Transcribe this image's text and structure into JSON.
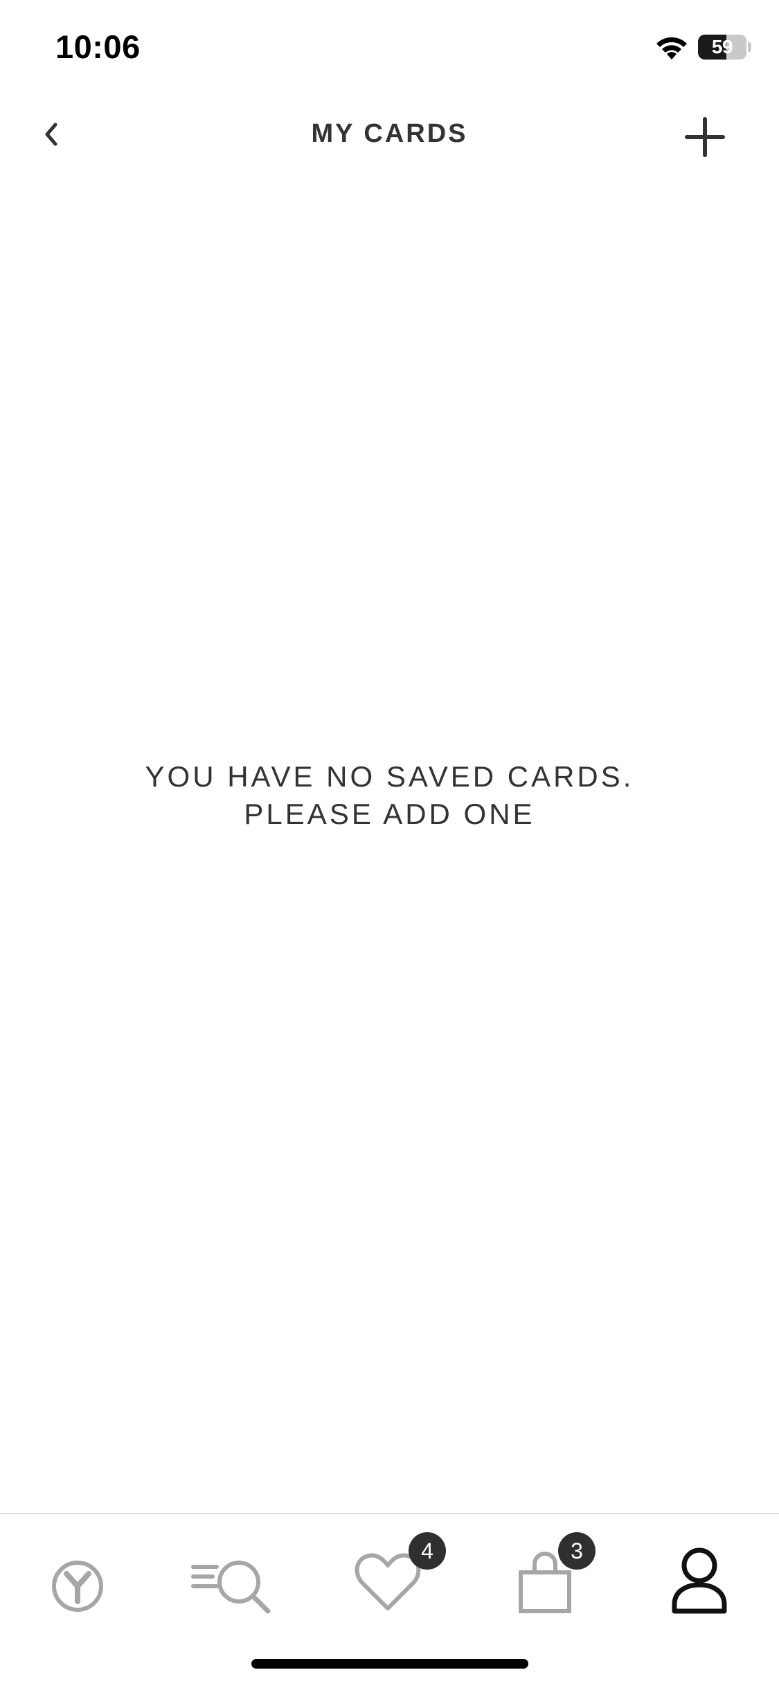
{
  "status_bar": {
    "time": "10:06",
    "battery_percent": "59"
  },
  "header": {
    "title": "MY CARDS",
    "back_icon": "chevron-left-icon",
    "add_icon": "plus-icon"
  },
  "empty_state": {
    "line1": "YOU HAVE NO SAVED CARDS.",
    "line2": "PLEASE ADD ONE"
  },
  "tab_bar": {
    "items": [
      {
        "icon": "brand-logo-icon",
        "active": false
      },
      {
        "icon": "menu-search-icon",
        "active": false
      },
      {
        "icon": "heart-icon",
        "badge": "4",
        "active": false
      },
      {
        "icon": "shopping-bag-icon",
        "badge": "3",
        "active": false
      },
      {
        "icon": "person-icon",
        "active": true
      }
    ]
  },
  "colors": {
    "text": "#333333",
    "inactive_icon": "#a6a6a6",
    "active_icon": "#111111",
    "badge_bg": "#2f2f2f"
  }
}
